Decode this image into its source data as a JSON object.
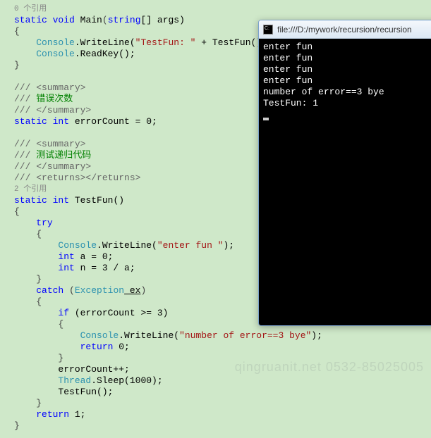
{
  "console": {
    "title": "file:///D:/mywork/recursion/recursion",
    "lines": [
      "enter fun",
      "enter fun",
      "enter fun",
      "enter fun",
      "number of error==3 bye",
      "TestFun: 1"
    ]
  },
  "watermark": "qingruanit.net 0532-85025005",
  "code": {
    "ref0": "0 个引用",
    "ref2": "2 个引用",
    "main_sig_static": "static",
    "main_sig_void": "void",
    "main_sig_name": "Main",
    "main_sig_string": "string",
    "main_sig_args": "[] args)",
    "console_cls": "Console",
    "writeline": ".WriteLine(",
    "str_testfun": "\"TestFun: \"",
    "plus_testfun": " + TestFun());",
    "readkey": ".ReadKey();",
    "summary_open": "/// <summary>",
    "summary_close": "/// </summary>",
    "returns": "/// <returns></returns>",
    "comment_err": "/// 错误次数",
    "comment_test": "/// 测试递归代码",
    "static_kw": "static",
    "int_kw": "int",
    "errorCount_decl": " errorCount = 0;",
    "testfun_name": " TestFun()",
    "try_kw": "try",
    "catch_kw": "catch",
    "exception_cls": "Exception",
    "ex_var": " ex",
    "str_enterfun": "\"enter fun \"",
    "closeparen_semi": ");",
    "int_a": " a = 0;",
    "int_n": " n = 3 / a;",
    "if_kw": "if",
    "if_cond": " (errorCount >= 3)",
    "str_numerr": "\"number of error==3 bye\"",
    "return_kw": "return",
    "return_0": " 0;",
    "return_1": " 1;",
    "errorcount_inc": "errorCount++;",
    "thread_cls": "Thread",
    "sleep": ".Sleep(1000);",
    "testfun_call": "TestFun();"
  }
}
